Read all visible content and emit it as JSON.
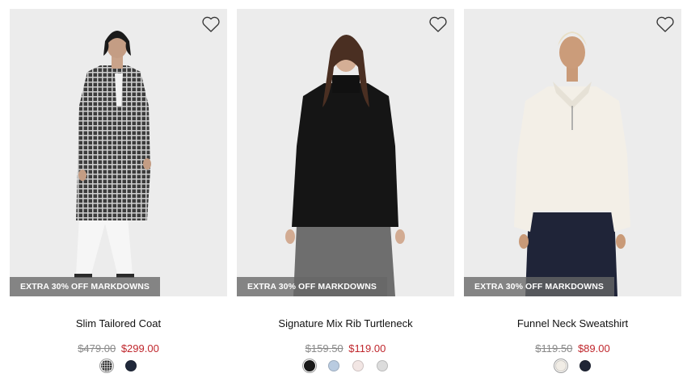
{
  "products": [
    {
      "name": "Slim Tailored Coat",
      "badge": "EXTRA 30% OFF MARKDOWNS",
      "original_price": "$479.00",
      "sale_price": "$299.00",
      "swatches": [
        "#4a4a4a",
        "#20283a"
      ]
    },
    {
      "name": "Signature Mix Rib Turtleneck",
      "badge": "EXTRA 30% OFF MARKDOWNS",
      "original_price": "$159.50",
      "sale_price": "$119.00",
      "swatches": [
        "#1a1a1a",
        "#b9cbe0",
        "#f2e6e4",
        "#dcdcdc"
      ]
    },
    {
      "name": "Funnel Neck Sweatshirt",
      "badge": "EXTRA 30% OFF MARKDOWNS",
      "original_price": "$119.50",
      "sale_price": "$89.00",
      "swatches": [
        "#f1ede6",
        "#1f2536"
      ]
    }
  ],
  "colors": {
    "sale_price": "#c0272d",
    "original_price": "#8a8a8a",
    "badge_bg": "#666666",
    "image_bg": "#ececec"
  },
  "icons": {
    "favorite": "heart-outline-icon"
  }
}
